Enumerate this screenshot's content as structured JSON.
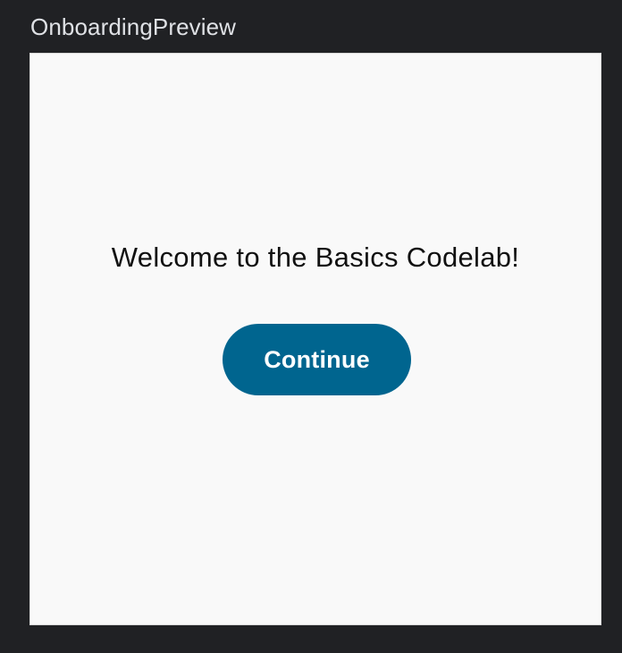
{
  "preview": {
    "title": "OnboardingPreview"
  },
  "screen": {
    "welcome_text": "Welcome to the Basics Codelab!",
    "continue_label": "Continue"
  },
  "colors": {
    "window_background": "#202124",
    "screen_background": "#f9f9f9",
    "button_background": "#00658f",
    "button_text": "#ffffff"
  }
}
